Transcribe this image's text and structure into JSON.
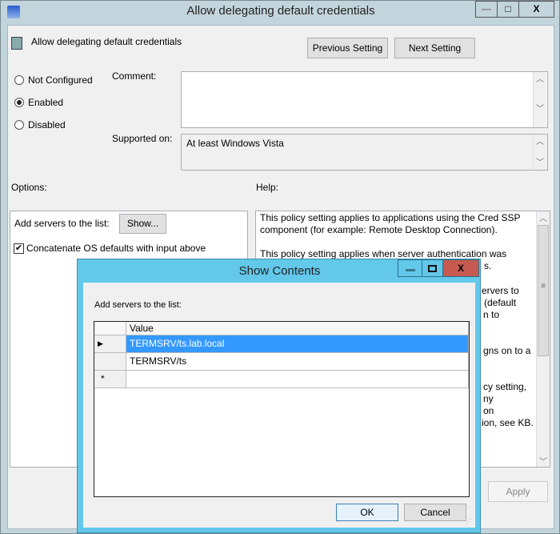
{
  "window": {
    "title": "Allow delegating default credentials",
    "minimize": "—",
    "maximize": "□",
    "close": "X"
  },
  "header": {
    "setting_name": "Allow delegating default credentials",
    "previous": "Previous Setting",
    "next": "Next Setting"
  },
  "state": {
    "options": [
      "Not Configured",
      "Enabled",
      "Disabled"
    ],
    "selected": "Enabled"
  },
  "comment": {
    "label": "Comment:",
    "value": ""
  },
  "supported": {
    "label": "Supported on:",
    "value": "At least Windows Vista"
  },
  "options_label": "Options:",
  "help_label": "Help:",
  "options": {
    "servers_label": "Add servers to the list:",
    "show_button": "Show...",
    "concat_label": "Concatenate OS defaults with input above",
    "concat_checked": true
  },
  "help": {
    "lines": [
      "This policy setting applies to applications using the Cred SSP",
      "component (for example: Remote Desktop Connection).",
      "This policy setting applies when server authentication was"
    ],
    "fragments": [
      "s.",
      "ervers to",
      "(default",
      "n to",
      "gns on to a",
      "cy setting,",
      "ny",
      "on",
      "ion, see KB."
    ]
  },
  "footer": {
    "apply": "Apply",
    "apply_enabled": false
  },
  "dialog": {
    "title": "Show Contents",
    "label": "Add servers to the list:",
    "column": "Value",
    "rows": [
      "TERMSRV/ts.lab.local",
      "TERMSRV/ts"
    ],
    "selected_row": 0,
    "new_row_marker": "*",
    "ok": "OK",
    "cancel": "Cancel"
  },
  "colors": {
    "dialog_title": "#63c8ea",
    "close_red": "#c75a50",
    "selection": "#3399ff"
  }
}
